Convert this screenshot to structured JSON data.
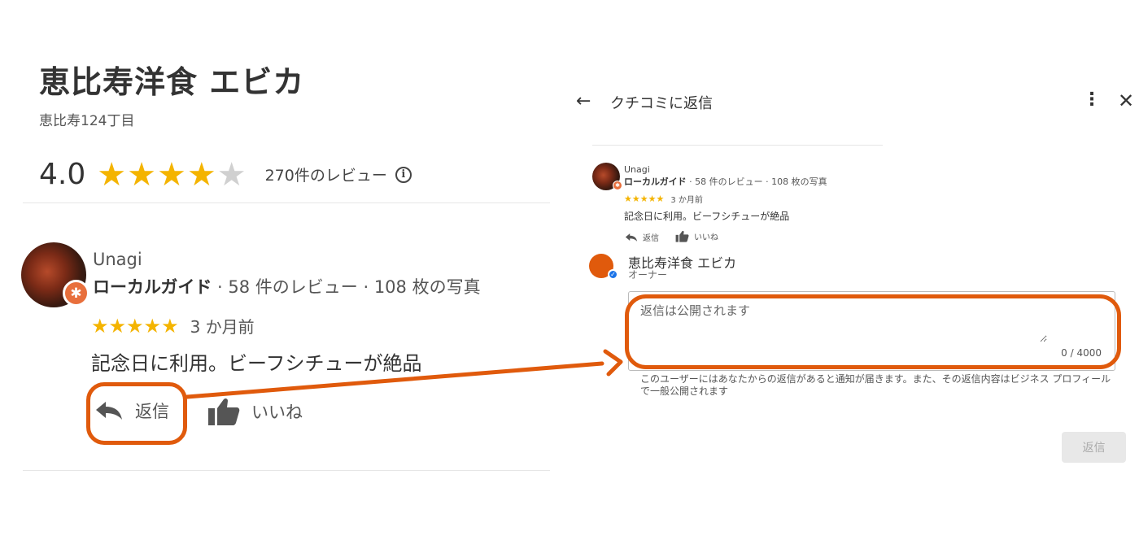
{
  "left": {
    "business_name": "恵比寿洋食 エビカ",
    "address": "恵比寿124丁目",
    "rating": "4.0",
    "stars": {
      "filled": 4,
      "total": 5
    },
    "review_count": "270件のレビュー",
    "info_glyph": "i",
    "review": {
      "user": "Unagi",
      "meta_bold": "ローカルガイド",
      "meta_rest": " · 58 件のレビュー · 108 枚の写真",
      "rating": 5,
      "stars_text": "★★★★★",
      "time": "3 か月前",
      "text": "記念日に利用。ビーフシチューが絶品",
      "reply_label": "返信",
      "like_label": "いいね"
    }
  },
  "dialog": {
    "title": "クチコミに返信",
    "back_glyph": "←",
    "more_glyph": "⋮",
    "close_glyph": "✕",
    "review": {
      "user": "Unagi",
      "meta_bold": "ローカルガイド",
      "meta_rest": " · 58 件のレビュー · 108 枚の写真",
      "stars_text": "★★★★★",
      "time": "3 か月前",
      "text": "記念日に利用。ビーフシチューが絶品",
      "reply_label": "返信",
      "like_label": "いいね"
    },
    "owner": {
      "name": "恵比寿洋食 エビカ",
      "role": "オーナー"
    },
    "reply_placeholder": "返信は公開されます",
    "counter": "0 / 4000",
    "notice": "このユーザーにはあなたからの返信があると通知が届きます。また、その返信内容はビジネス プロフィールで一般公開されます",
    "submit_label": "返信"
  },
  "colors": {
    "highlight": "#e05a0c",
    "star": "#f4b400",
    "verified": "#1a73e8"
  },
  "icons": [
    "reply-icon",
    "thumbs-up-icon",
    "info-icon",
    "back-arrow-icon",
    "more-vert-icon",
    "close-icon",
    "local-guide-badge-icon",
    "verified-check-icon"
  ]
}
